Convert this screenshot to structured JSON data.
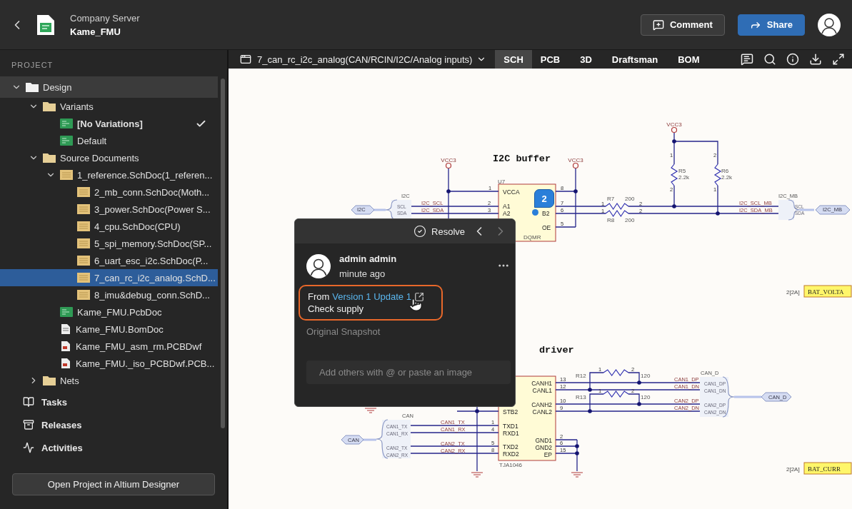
{
  "header": {
    "server": "Company Server",
    "project": "Kame_FMU",
    "comment_button": "Comment",
    "share_button": "Share"
  },
  "sidebar": {
    "heading": "PROJECT",
    "tree": [
      {
        "label": "Design",
        "kind": "design",
        "expanded": true,
        "selected": false,
        "children": [
          {
            "label": "Variants",
            "kind": "folder",
            "expanded": true,
            "selected": false,
            "children": [
              {
                "label": "[No Variations]",
                "kind": "variant",
                "checked": true,
                "selected": false
              },
              {
                "label": "Default",
                "kind": "variant",
                "checked": false,
                "selected": false
              }
            ]
          },
          {
            "label": "Source Documents",
            "kind": "folder",
            "expanded": true,
            "selected": false,
            "children": [
              {
                "label": "1_reference.SchDoc(1_referen...",
                "kind": "schdoc",
                "expanded": true,
                "selected": false,
                "children": [
                  {
                    "label": "2_mb_conn.SchDoc(Moth...",
                    "kind": "schdoc",
                    "selected": false
                  },
                  {
                    "label": "3_power.SchDoc(Power S...",
                    "kind": "schdoc",
                    "selected": false
                  },
                  {
                    "label": "4_cpu.SchDoc(CPU)",
                    "kind": "schdoc",
                    "selected": false
                  },
                  {
                    "label": "5_spi_memory.SchDoc(SP...",
                    "kind": "schdoc",
                    "selected": false
                  },
                  {
                    "label": "6_uart_esc_i2c.SchDoc(P...",
                    "kind": "schdoc",
                    "selected": false
                  },
                  {
                    "label": "7_can_rc_i2c_analog.SchD...",
                    "kind": "schdoc",
                    "selected": true
                  },
                  {
                    "label": "8_imu&debug_conn.SchD...",
                    "kind": "schdoc",
                    "selected": false
                  }
                ]
              },
              {
                "label": "Kame_FMU.PcbDoc",
                "kind": "pcbdoc",
                "selected": false
              },
              {
                "label": "Kame_FMU.BomDoc",
                "kind": "bomdoc",
                "selected": false
              },
              {
                "label": "Kame_FMU_asm_rm.PCBDwf",
                "kind": "pcbdwf",
                "selected": false
              },
              {
                "label": "Kame_FMU._iso_PCBDwf.PCB...",
                "kind": "pcbdwf",
                "selected": false
              }
            ]
          },
          {
            "label": "Nets",
            "kind": "folder",
            "expanded": false,
            "selected": false
          }
        ]
      }
    ],
    "nav": [
      {
        "label": "Tasks",
        "kind": "tasks"
      },
      {
        "label": "Releases",
        "kind": "releases"
      },
      {
        "label": "Activities",
        "kind": "activity"
      }
    ],
    "open_button": "Open Project in Altium Designer"
  },
  "toolbar": {
    "document": "7_can_rc_i2c_analog(CAN/RCIN/I2C/Analog inputs)",
    "tabs": [
      {
        "label": "SCH",
        "selected": true
      },
      {
        "label": "PCB",
        "selected": false
      },
      {
        "label": "3D",
        "selected": false
      },
      {
        "label": "Draftsman",
        "selected": false
      },
      {
        "label": "BOM",
        "selected": false
      }
    ]
  },
  "schematic": {
    "comment_marker": "2",
    "labels": [
      {
        "text": "VCC3",
        "kind": "power"
      },
      {
        "text": "VCC3",
        "kind": "power"
      },
      {
        "text": "I2C buffer",
        "kind": "title"
      },
      {
        "text": "VCC3",
        "kind": "power"
      },
      {
        "text": "U7",
        "kind": "designator"
      },
      {
        "text": "1",
        "kind": "pin"
      },
      {
        "text": "8",
        "kind": "pin"
      },
      {
        "text": "2",
        "kind": "pin"
      },
      {
        "text": "3",
        "kind": "pin"
      },
      {
        "text": "7",
        "kind": "pin"
      },
      {
        "text": "6",
        "kind": "pin"
      },
      {
        "text": "5",
        "kind": "pin"
      },
      {
        "text": "VCCA",
        "kind": "pinname"
      },
      {
        "text": "A1",
        "kind": "pinname"
      },
      {
        "text": "A2",
        "kind": "pinname"
      },
      {
        "text": "B2",
        "kind": "pinname"
      },
      {
        "text": "OE",
        "kind": "pinname"
      },
      {
        "text": "DQMR",
        "kind": "designator"
      },
      {
        "text": "I2C",
        "kind": "harness"
      },
      {
        "text": "SCL",
        "kind": "entry"
      },
      {
        "text": "SDA",
        "kind": "entry"
      },
      {
        "text": "I2C",
        "kind": "port"
      },
      {
        "text": "I2C_SCL",
        "kind": "net"
      },
      {
        "text": "I2C_SDA",
        "kind": "net"
      },
      {
        "text": "R7",
        "kind": "designator"
      },
      {
        "text": "200",
        "kind": "designator"
      },
      {
        "text": "R8",
        "kind": "designator"
      },
      {
        "text": "200",
        "kind": "designator"
      },
      {
        "text": "1",
        "kind": "pin"
      },
      {
        "text": "1",
        "kind": "pin"
      },
      {
        "text": "2",
        "kind": "pin"
      },
      {
        "text": "2",
        "kind": "pin"
      },
      {
        "text": "R5",
        "kind": "designator"
      },
      {
        "text": "2.2k",
        "kind": "designator"
      },
      {
        "text": "R6",
        "kind": "designator"
      },
      {
        "text": "2.2k",
        "kind": "designator"
      },
      {
        "text": "1",
        "kind": "pin"
      },
      {
        "text": "2",
        "kind": "pin"
      },
      {
        "text": "2",
        "kind": "pin"
      },
      {
        "text": "1",
        "kind": "pin"
      },
      {
        "text": "I2C_MB",
        "kind": "harness"
      },
      {
        "text": "SCL",
        "kind": "entry"
      },
      {
        "text": "SDA",
        "kind": "entry"
      },
      {
        "text": "I2C_SCL_MB",
        "kind": "net"
      },
      {
        "text": "I2C_SDA_MB",
        "kind": "net"
      },
      {
        "text": "I2C_MB",
        "kind": "port"
      },
      {
        "text": "2[2A]",
        "kind": "sheetref"
      },
      {
        "text": "BAT_VOLTA",
        "kind": "offsheet"
      },
      {
        "text": "driver",
        "kind": "title"
      },
      {
        "text": "R12",
        "kind": "designator"
      },
      {
        "text": "1",
        "kind": "pin"
      },
      {
        "text": "2",
        "kind": "pin"
      },
      {
        "text": "120",
        "kind": "designator"
      },
      {
        "text": "R13",
        "kind": "designator"
      },
      {
        "text": "1",
        "kind": "pin"
      },
      {
        "text": "2",
        "kind": "pin"
      },
      {
        "text": "120",
        "kind": "designator"
      },
      {
        "text": "CANH1",
        "kind": "pinname"
      },
      {
        "text": "CANL1",
        "kind": "pinname"
      },
      {
        "text": "CANH2",
        "kind": "pinname"
      },
      {
        "text": "CANL2",
        "kind": "pinname"
      },
      {
        "text": "13",
        "kind": "pin"
      },
      {
        "text": "12",
        "kind": "pin"
      },
      {
        "text": "10",
        "kind": "pin"
      },
      {
        "text": "9",
        "kind": "pin"
      },
      {
        "text": "STB2",
        "kind": "pinname"
      },
      {
        "text": "TXD1",
        "kind": "pinname"
      },
      {
        "text": "RXD1",
        "kind": "pinname"
      },
      {
        "text": "TXD2",
        "kind": "pinname"
      },
      {
        "text": "RXD2",
        "kind": "pinname"
      },
      {
        "text": "1",
        "kind": "pin"
      },
      {
        "text": "4",
        "kind": "pin"
      },
      {
        "text": "5",
        "kind": "pin"
      },
      {
        "text": "8",
        "kind": "pin"
      },
      {
        "text": "GND1",
        "kind": "pinname"
      },
      {
        "text": "GND2",
        "kind": "pinname"
      },
      {
        "text": "EP",
        "kind": "pinname"
      },
      {
        "text": "2",
        "kind": "pin"
      },
      {
        "text": "6",
        "kind": "pin"
      },
      {
        "text": "15",
        "kind": "pin"
      },
      {
        "text": "TJA1046",
        "kind": "designator"
      },
      {
        "text": "CAN1_TX",
        "kind": "net"
      },
      {
        "text": "CAN1_RX",
        "kind": "net"
      },
      {
        "text": "CAN2_TX",
        "kind": "net"
      },
      {
        "text": "CAN2_RX",
        "kind": "net"
      },
      {
        "text": "CAN",
        "kind": "harness"
      },
      {
        "text": "CAN1_TX",
        "kind": "entry"
      },
      {
        "text": "CAN1_RX",
        "kind": "entry"
      },
      {
        "text": "CAN2_TX",
        "kind": "entry"
      },
      {
        "text": "CAN2_RX",
        "kind": "entry"
      },
      {
        "text": "CAN",
        "kind": "port"
      },
      {
        "text": "CAN1_DP",
        "kind": "net"
      },
      {
        "text": "CAN1_DN",
        "kind": "net"
      },
      {
        "text": "CAN2_DP",
        "kind": "net"
      },
      {
        "text": "CAN2_DN",
        "kind": "net"
      },
      {
        "text": "CAN_D",
        "kind": "harness"
      },
      {
        "text": "CAN1_DP",
        "kind": "entry"
      },
      {
        "text": "CAN1_DN",
        "kind": "entry"
      },
      {
        "text": "CAN2_DP",
        "kind": "entry"
      },
      {
        "text": "CAN2_DN",
        "kind": "entry"
      },
      {
        "text": "CAN_D",
        "kind": "port"
      },
      {
        "text": "2[2A]",
        "kind": "sheetref"
      },
      {
        "text": "BAT_CURR",
        "kind": "offsheet"
      }
    ]
  },
  "comment": {
    "resolve": "Resolve",
    "author": "admin admin",
    "time": "minute ago",
    "source_prefix": "From",
    "source_link": "Version 1 Update 1",
    "body": "Check supply",
    "highlighted": true,
    "snapshot": "Original Snapshot",
    "reply_placeholder": "Add others with @ or paste an image"
  }
}
